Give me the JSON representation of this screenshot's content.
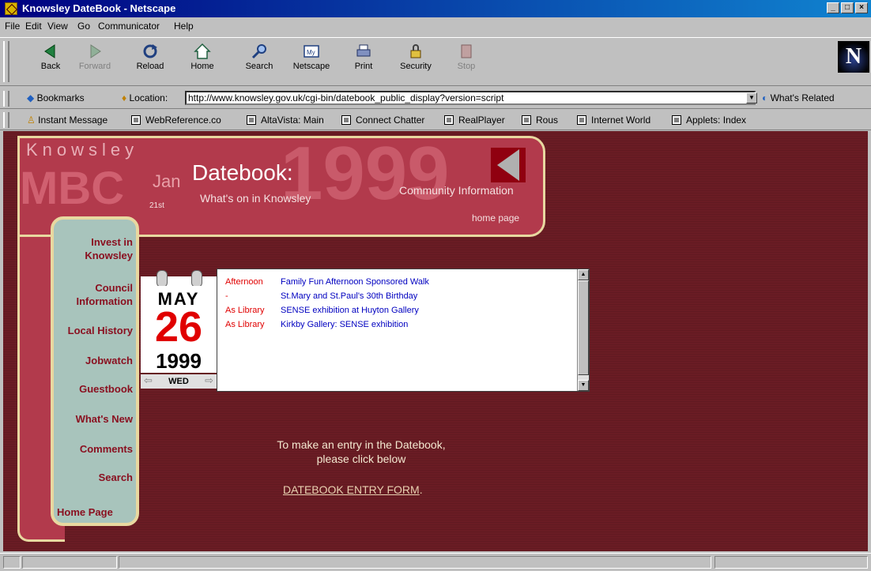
{
  "window": {
    "title": "Knowsley DateBook - Netscape"
  },
  "menu": [
    "File",
    "Edit",
    "View",
    "Go",
    "Communicator",
    "Help"
  ],
  "toolbar": [
    {
      "label": "Back",
      "icon": "back-arrow-icon",
      "enabled": true
    },
    {
      "label": "Forward",
      "icon": "forward-arrow-icon",
      "enabled": false
    },
    {
      "label": "Reload",
      "icon": "reload-icon",
      "enabled": true
    },
    {
      "label": "Home",
      "icon": "home-icon",
      "enabled": true
    },
    {
      "label": "Search",
      "icon": "search-icon",
      "enabled": true
    },
    {
      "label": "Netscape",
      "icon": "netscape-icon",
      "enabled": true
    },
    {
      "label": "Print",
      "icon": "print-icon",
      "enabled": true
    },
    {
      "label": "Security",
      "icon": "lock-icon",
      "enabled": true
    },
    {
      "label": "Stop",
      "icon": "stop-icon",
      "enabled": false
    }
  ],
  "location": {
    "bookmarks_label": "Bookmarks",
    "location_label": "Location:",
    "url": "http://www.knowsley.gov.uk/cgi-bin/datebook_public_display?version=script",
    "whats_related": "What's Related"
  },
  "personal_toolbar": [
    "Instant Message",
    "WebReference.co",
    "AltaVista: Main",
    "Connect Chatter",
    "RealPlayer",
    "Rous",
    "Internet World",
    "Applets: Index"
  ],
  "banner": {
    "knowsley": "Knowsley",
    "mbc": "MBC",
    "jan": "Jan",
    "datebook": "Datebook:",
    "whats_on": "What's on in Knowsley",
    "community": "Community Information",
    "home_page": "home page",
    "st": "21st"
  },
  "nav": [
    {
      "label": "Invest in\nKnowsley"
    },
    {
      "label": "Council\nInformation"
    },
    {
      "label": "Local History"
    },
    {
      "label": "Jobwatch"
    },
    {
      "label": "Guestbook"
    },
    {
      "label": "What's New"
    },
    {
      "label": "Comments"
    },
    {
      "label": "Search"
    },
    {
      "label": "Home Page"
    }
  ],
  "calendar": {
    "month": "MAY",
    "day": "26",
    "year": "1999",
    "weekday": "WED"
  },
  "events": [
    {
      "time": "Afternoon",
      "title": "Family Fun Afternoon Sponsored Walk"
    },
    {
      "time": "-",
      "title": "St.Mary and St.Paul's 30th Birthday"
    },
    {
      "time": "As Library",
      "title": "SENSE exhibition at Huyton Gallery"
    },
    {
      "time": "As Library",
      "title": "Kirkby Gallery: SENSE exhibition"
    }
  ],
  "entry": {
    "line1": "To make an entry in the Datebook,",
    "line2": "please click below",
    "link": "DATEBOOK ENTRY FORM",
    "period": "."
  },
  "colors": {
    "page_bg": "#6a1c24",
    "nav_bg": "#a8c4bc",
    "nav_text": "#8a1020",
    "time_text": "#e00000",
    "event_text": "#0000c0"
  }
}
